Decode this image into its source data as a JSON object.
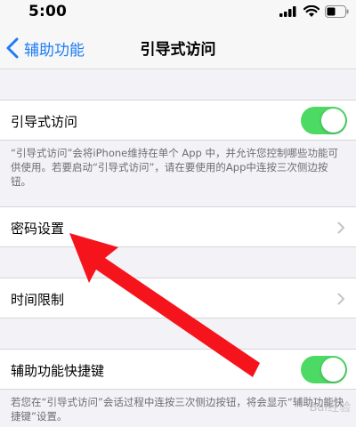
{
  "status_bar": {
    "time": "5:00"
  },
  "nav": {
    "back_label": "辅助功能",
    "title": "引导式访问"
  },
  "guided_access": {
    "label": "引导式访问",
    "toggle_on": true,
    "description": "“引导式访问”会将iPhone维持在单个 App 中，并允许您控制哪些功能可供使用。若要启动“引导式访问”，请在要使用的App中连按三次侧边按钮。"
  },
  "passcode_settings": {
    "label": "密码设置"
  },
  "time_limits": {
    "label": "时间限制"
  },
  "accessibility_shortcut": {
    "label": "辅助功能快捷键",
    "toggle_on": true,
    "description": "若您在“引导式访问”会话过程中连按三次侧边按钮，将会显示“辅助功能快捷键”设置。"
  },
  "colors": {
    "accent": "#1f7cf4",
    "toggle_on": "#4cd964",
    "arrow": "#f5141b"
  },
  "icons": [
    "signal-icon",
    "wifi-icon",
    "battery-icon",
    "chevron-left-icon",
    "chevron-right-icon",
    "red-arrow"
  ],
  "watermark": "Bai经验"
}
